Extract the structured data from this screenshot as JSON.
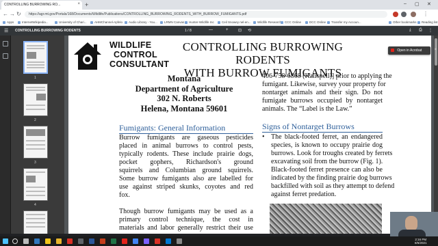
{
  "browser": {
    "tab_title": "CONTROLLING BURROWING RO...",
    "url": "https://agr.mt.gov/Portals/168/Documents/Wildlife/Publications/CONTROLLING_BURROWING_RODENTS_WITH_BURROW_FUMIGANTS.pdf",
    "bookmarks": [
      "Apps",
      "InternetWikipedia...",
      "University of Chari...",
      "AHMChannel-Apfelo",
      "Audio Library - You...",
      "LRMN Canvas",
      "Hunter-Wildlife Inc",
      "Ceil Snowey nel-en...",
      "Wildlife Research",
      "CCC Online",
      "DCC Online",
      "Transfer my Accoun...",
      "Other bookmarks",
      "Reading list"
    ]
  },
  "pdf_toolbar": {
    "title": "CONTROLLING BURROWING RODENTS",
    "page_current": "1",
    "page_total": "8"
  },
  "thumbnails": [
    "1",
    "2",
    "3",
    "4",
    "5"
  ],
  "acrobat_button": "Open in Acrobat",
  "document": {
    "logo_lines": [
      "WILDLIFE",
      "CONTROL",
      "CONSULTANT"
    ],
    "title_lines": [
      "CONTROLLING BURROWING RODENTS",
      "WITH BURROW FUMIGANTS"
    ],
    "address_lines": [
      "Montana",
      "Department of Agriculture",
      "302 N. Roberts",
      "Helena, Montana 59601"
    ],
    "section1_heading": "Fumigants: General Information",
    "section1_para1_lines": [
      "Burrow fumigants are gaseous pesticides",
      "placed in animal burrows to control pests,",
      "typically rodents. These include prairie dogs,",
      "pocket gophers, Richardson's ground",
      "squirrels and Columbian ground squirrels.",
      "Some burrow fumigants also are labelled for",
      "use against striped skunks, coyotes and red",
      "fox."
    ],
    "section1_para2_lines": [
      "Though burrow fumigants may be used as a",
      "primary control technique, the cost in",
      "materials and labor generally restrict their use"
    ],
    "right_para_lines": [
      "406-758-6868 (Kalispell)] prior to applying the",
      "fumigant. Likewise, survey your property for",
      "nontarget animals and their sign. Do not",
      "fumigate burrows occupied by nontarget",
      "animals. The “Label is the Law.”"
    ],
    "section2_heading": "Signs of Nontarget Burrows",
    "bullet_lines": [
      "The black-footed ferret, an endangered",
      "species, is known to occupy prairie dog",
      "burrows. Look for troughs created by ferrets",
      "excavating soil from the burrow (Fig. 1).",
      "Black-footed ferret presence can also be",
      "indicated by the finding prairie dog burrows",
      "backfilled with soil as they attempt to defend",
      "against ferret predation."
    ]
  },
  "taskbar": {
    "time": "2:16 PM",
    "date": "8/6/2021"
  },
  "colors": {
    "heading_blue": "#2e5f9a",
    "pdf_toolbar": "#323639",
    "viewer_bg": "#525659"
  }
}
